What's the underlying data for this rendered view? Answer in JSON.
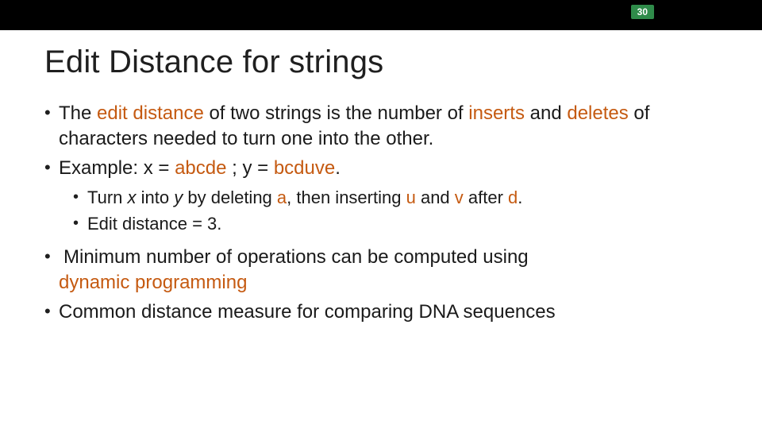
{
  "header": {
    "page_number": "30"
  },
  "slide": {
    "title": "Edit Distance for strings",
    "b1": {
      "t1": "The ",
      "t2": "edit distance ",
      "t3": " of two strings is the number of ",
      "t4": "inserts",
      "t5": " and ",
      "t6": "deletes",
      "t7": " of characters needed to turn one into the other."
    },
    "b2": {
      "t1": "Example:  x = ",
      "t2": "abcde",
      "t3": " ; y = ",
      "t4": "bcduve",
      "t5": "."
    },
    "sub1": {
      "t1": "Turn ",
      "t2": "x ",
      "t3": " into ",
      "t4": "y ",
      "t5": " by deleting ",
      "t6": "a",
      "t7": ", then inserting ",
      "t8": "u ",
      "t9": " and ",
      "t10": "v ",
      "t11": " after ",
      "t12": "d",
      "t13": "."
    },
    "sub2": {
      "t1": "Edit distance = 3."
    },
    "b3": {
      "t1": " Minimum number of operations can be computed using ",
      "t2": "dynamic programming"
    },
    "b4": {
      "t1": "Common distance measure for comparing DNA sequences"
    }
  }
}
